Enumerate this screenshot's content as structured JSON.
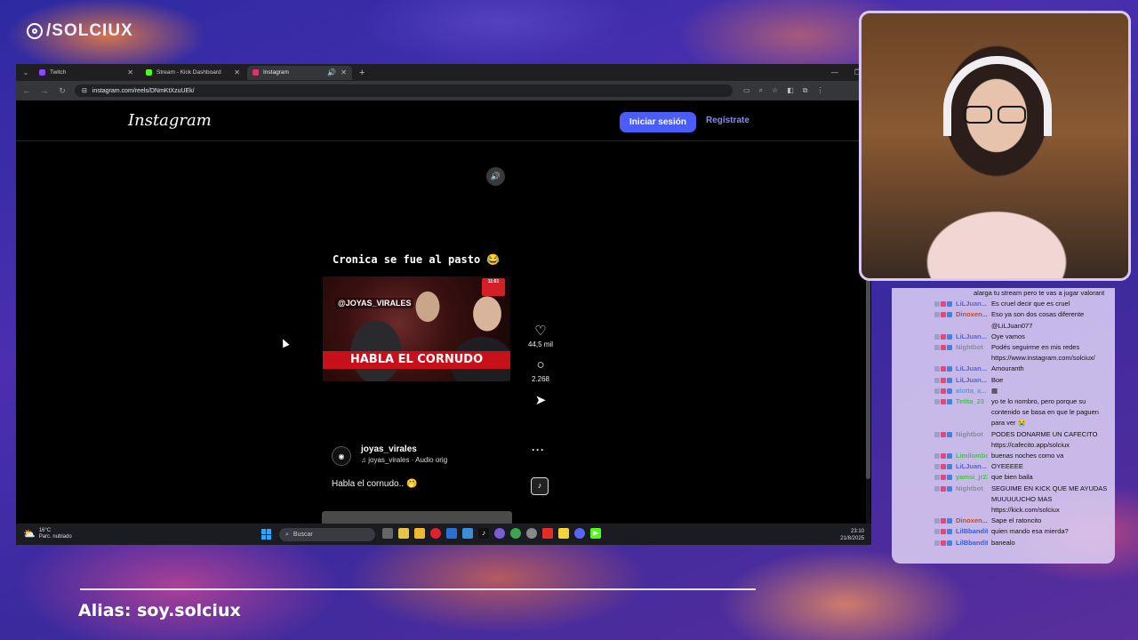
{
  "overlay": {
    "brand": "/SOLCIUX",
    "alias": "Alias: soy.solciux"
  },
  "browser": {
    "tabs": [
      {
        "label": "Twitch",
        "color": "#9146ff"
      },
      {
        "label": "Stream - Kick Dashboard",
        "color": "#53fc18"
      },
      {
        "label": "Instagram",
        "color": "#e1306c"
      }
    ],
    "url": "instagram.com/reels/DNmKtXzuUEk/"
  },
  "instagram": {
    "logo": "Instagram",
    "login_label": "Iniciar sesión",
    "register_label": "Regístrate",
    "reel": {
      "title": "Cronica se fue al pasto 😂",
      "video_tag": "@JOYAS_VIRALES",
      "video_banner": "HABLA EL CORNUDO",
      "tv_logo": "11:61",
      "likes": "44,5 mil",
      "comments": "2.268",
      "author": "joyas_virales",
      "audio": "♫ joyas_virales · Audio orig",
      "caption": "Habla el cornudo.. 🤭"
    }
  },
  "taskbar": {
    "weather_temp": "16°C",
    "weather_desc": "Parc. nublado",
    "search_placeholder": "Buscar",
    "time": "23:10",
    "date": "21/8/2025"
  },
  "chat": [
    {
      "user": "",
      "msg": "alarga tu stream pero te vas a jugar valorant",
      "color": "#222"
    },
    {
      "user": "LiLJuan...",
      "msg": "Es cruel decir que es cruel",
      "color": "#5b63c9"
    },
    {
      "user": "Dinoxen...",
      "msg": "Eso ya son dos cosas diferente @LiLJuan077",
      "color": "#c04a2a"
    },
    {
      "user": "LiLJuan...",
      "msg": "Oye vamos",
      "color": "#5b63c9"
    },
    {
      "user": "Nightbot",
      "msg": "Podés seguirme en mis redes https://www.instagram.com/solciux/",
      "color": "#8a8aa0"
    },
    {
      "user": "LiLJuan...",
      "msg": "Amouranth",
      "color": "#5b63c9"
    },
    {
      "user": "LiLJuan...",
      "msg": "Boe",
      "color": "#5b63c9"
    },
    {
      "user": "alotta_a...",
      "msg": "▦",
      "color": "#5a9fd4"
    },
    {
      "user": "Tetita_23",
      "msg": "yo te lo nombro, pero porque su contenido se basa en que le paguen para ver 😭",
      "color": "#47c24a"
    },
    {
      "user": "Nightbot",
      "msg": "PODES DONARME UN CAFECITO https://cafecito.app/solciux",
      "color": "#8a8aa0"
    },
    {
      "user": "Limilombo",
      "msg": "buenas noches como va",
      "color": "#47c24a"
    },
    {
      "user": "LiLJuan...",
      "msg": "OYEEEEE",
      "color": "#5b63c9"
    },
    {
      "user": "yamsi_jr23",
      "msg": "que bien baila",
      "color": "#47c24a"
    },
    {
      "user": "Nightbot",
      "msg": "SEGUIME EN KICK QUE ME AYUDAS MUUUUUCHO MAS https://kick.com/solciux",
      "color": "#8a8aa0"
    },
    {
      "user": "Dinoxen...",
      "msg": "Sape el ratoncito",
      "color": "#c04a2a"
    },
    {
      "user": "LilBbandit",
      "msg": "quien mando esa mierda?",
      "color": "#3a5bd0"
    },
    {
      "user": "LilBbandit",
      "msg": "banealo",
      "color": "#3a5bd0"
    }
  ]
}
